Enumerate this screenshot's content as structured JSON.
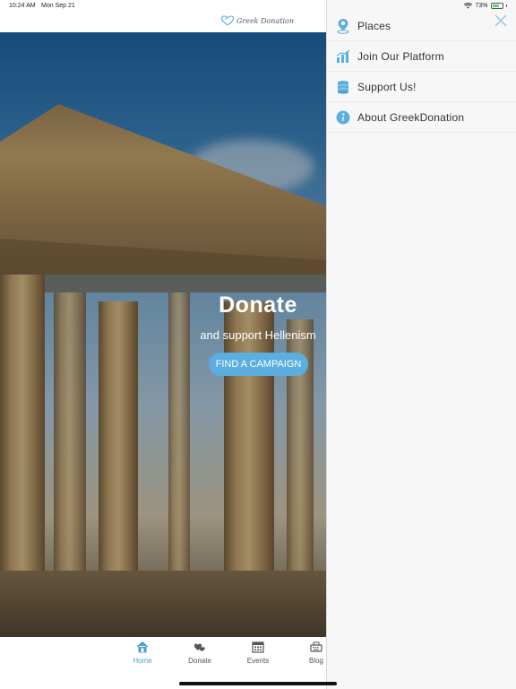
{
  "status_bar": {
    "time": "10:24 AM",
    "date": "Mon Sep 21",
    "battery": "73%",
    "battery_level": 0.73
  },
  "header": {
    "logo_text": "Greek Donation"
  },
  "hero": {
    "title": "Donate",
    "subtitle": "and support Hellenism",
    "button_label": "FIND A CAMPAIGN"
  },
  "tabs": [
    {
      "label": "Home",
      "icon": "home-icon",
      "active": true
    },
    {
      "label": "Donate",
      "icon": "hearts-icon",
      "active": false
    },
    {
      "label": "Events",
      "icon": "calendar-icon",
      "active": false
    },
    {
      "label": "Blog",
      "icon": "typewriter-icon",
      "active": false
    }
  ],
  "drawer": {
    "items": [
      {
        "label": "Places",
        "icon": "map-pin-icon"
      },
      {
        "label": "Join Our Platform",
        "icon": "bar-chart-icon"
      },
      {
        "label": "Support Us!",
        "icon": "coins-icon"
      },
      {
        "label": "About GreekDonation",
        "icon": "info-icon"
      }
    ]
  },
  "colors": {
    "accent": "#4a9fd6",
    "button": "#5aaee0",
    "drawer_bg": "#f7f7f7"
  }
}
